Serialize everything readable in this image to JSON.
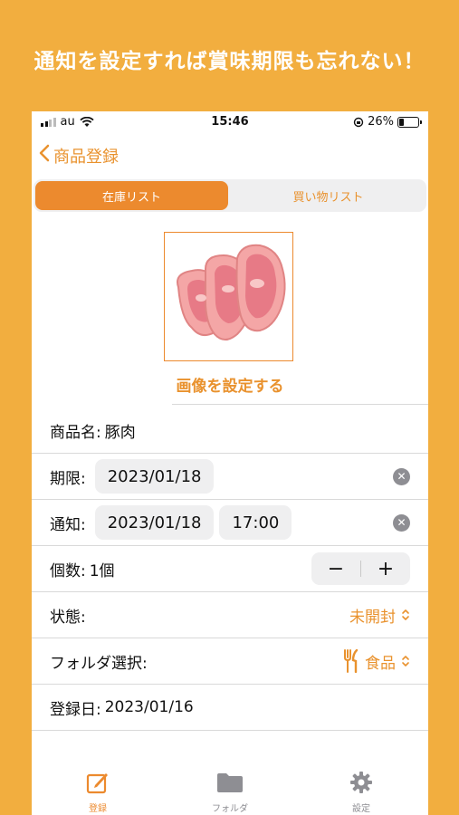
{
  "headline": "通知を設定すれば賞味期限も忘れない！",
  "status_bar": {
    "carrier": "au",
    "time": "15:46",
    "battery": "26%"
  },
  "nav": {
    "title": "商品登録"
  },
  "segments": {
    "active": "在庫リスト",
    "inactive": "買い物リスト"
  },
  "image": {
    "set_label": "画像を設定する"
  },
  "form": {
    "name_label": "商品名:",
    "name_value": "豚肉",
    "expiry_label": "期限:",
    "expiry_date": "2023/01/18",
    "notify_label": "通知:",
    "notify_date": "2023/01/18",
    "notify_time": "17:00",
    "quantity_label": "個数:",
    "quantity_value": "1個",
    "state_label": "状態:",
    "state_value": "未開封",
    "folder_label": "フォルダ選択:",
    "folder_value": "食品",
    "registered_label": "登録日:",
    "registered_value": "2023/01/16"
  },
  "tabbar": {
    "register": "登録",
    "folder": "フォルダ",
    "settings": "設定"
  },
  "colors": {
    "accent": "#EC8A2E",
    "background": "#F2AE3F",
    "inactive_tab": "#8E8E93"
  }
}
